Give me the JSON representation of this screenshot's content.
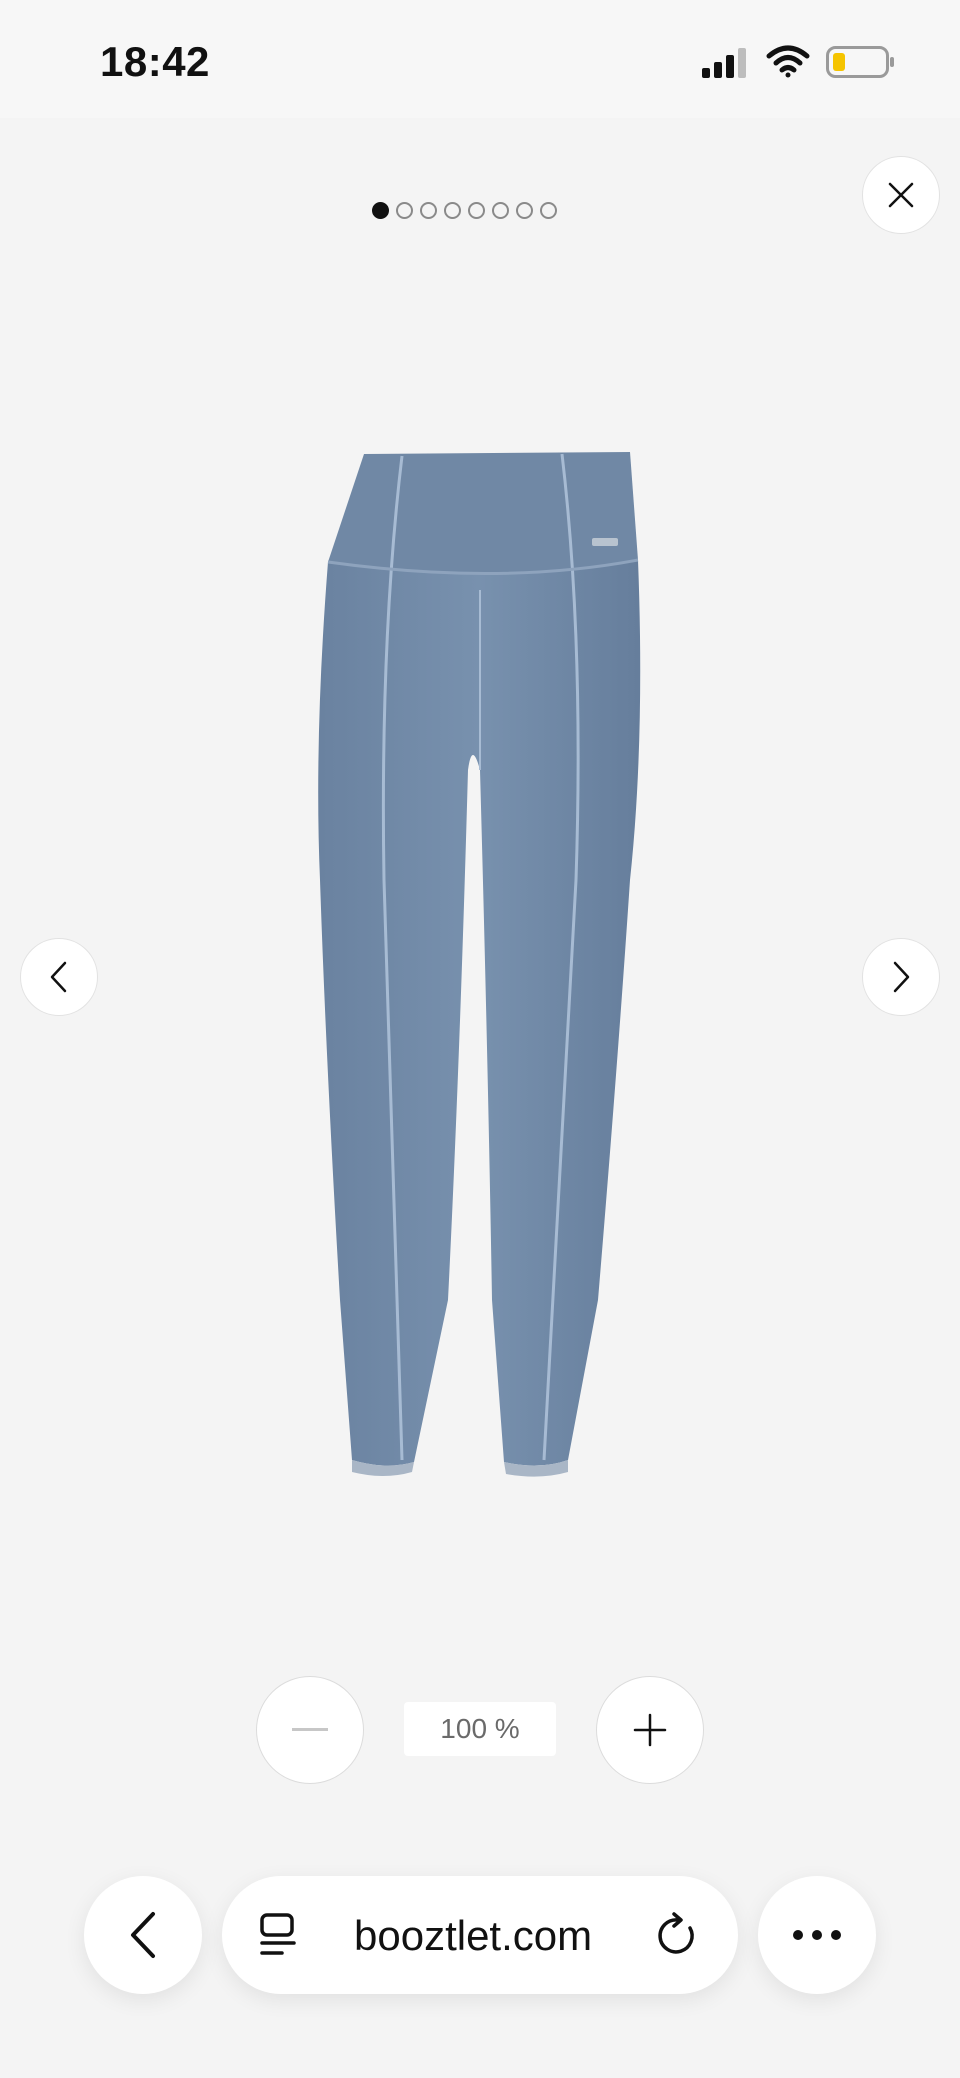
{
  "status_bar": {
    "time": "18:42",
    "icons": [
      "cellular-signal-icon",
      "wifi-icon",
      "battery-low-icon"
    ],
    "battery_color": "#f5c400"
  },
  "gallery": {
    "image_count": 8,
    "active_index": 0,
    "product_image": "blue-leggings-image",
    "product_color": "#6f88a6",
    "controls": {
      "close_icon": "close-icon",
      "prev_icon": "chevron-left-icon",
      "next_icon": "chevron-right-icon"
    }
  },
  "zoom": {
    "level": "100 %",
    "minus_icon": "minus-icon",
    "plus_icon": "plus-icon"
  },
  "browser": {
    "url": "booztlet.com",
    "icons": [
      "back-arrow-icon",
      "tabs-icon",
      "reload-icon",
      "more-icon"
    ]
  }
}
